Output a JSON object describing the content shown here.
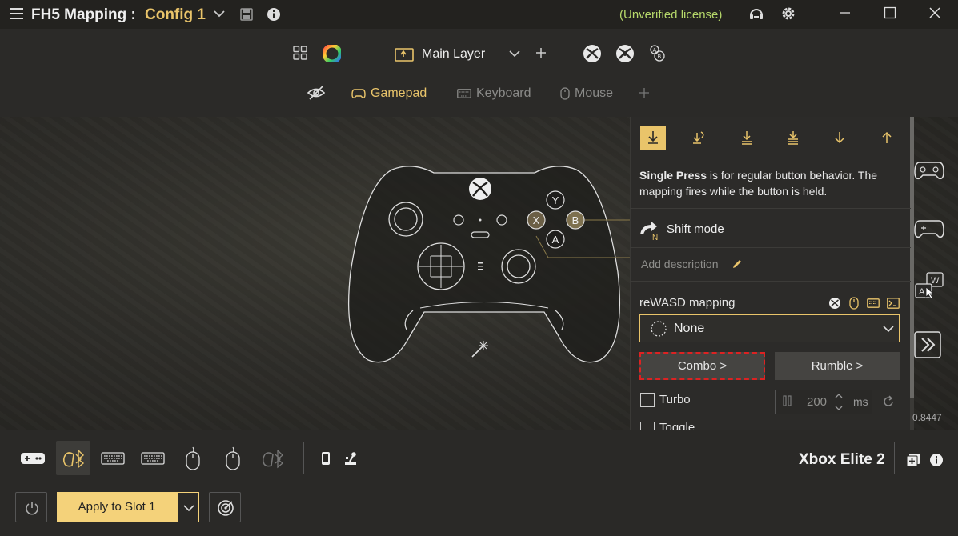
{
  "title_bar": {
    "app_title": "FH5 Mapping :",
    "config_name": "Config 1",
    "license": "(Unverified license)"
  },
  "layer_bar": {
    "layer_name": "Main Layer"
  },
  "tabs": [
    {
      "label": "Gamepad",
      "state": "active"
    },
    {
      "label": "Keyboard",
      "state": "inactive"
    },
    {
      "label": "Mouse",
      "state": "inactive"
    }
  ],
  "controller": {
    "face_buttons": [
      "Y",
      "X",
      "B",
      "A"
    ]
  },
  "panel": {
    "description_bold": "Single Press",
    "description_rest": " is for regular button behavior. The mapping fires while the button is held.",
    "shift_mode_label": "Shift mode",
    "shift_badge": "N",
    "add_description": "Add description",
    "rewasd_mapping_label": "reWASD mapping",
    "mapping_value": "None",
    "combo_button": "Combo >",
    "rumble_button": "Rumble >",
    "turbo_label": "Turbo",
    "turbo_value": "200",
    "turbo_unit": "ms",
    "toggle_label": "Toggle"
  },
  "right_rail": {
    "version": "0.8447",
    "keyboard_keys": [
      "W",
      "A"
    ]
  },
  "bottom": {
    "device_name": "Xbox Elite 2",
    "apply_label": "Apply to Slot 1"
  },
  "colors": {
    "accent": "#e9c46a",
    "license_green": "#b6d86a",
    "combo_border": "#dd2222"
  }
}
